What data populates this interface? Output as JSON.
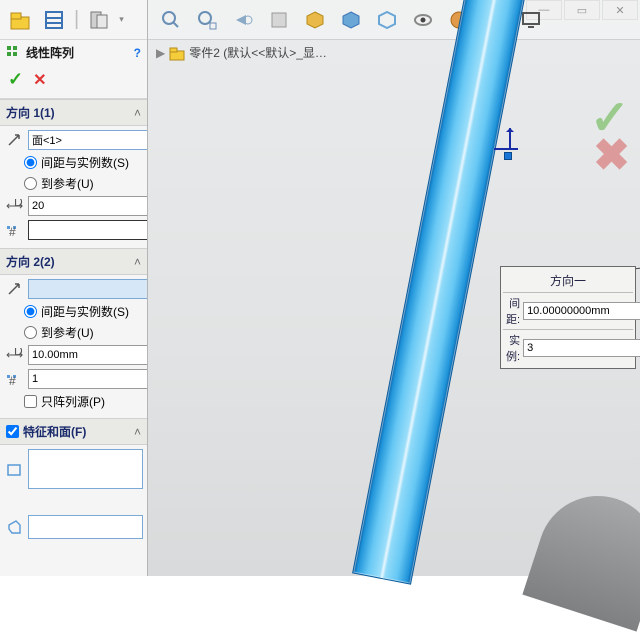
{
  "command": {
    "title": "线性阵列"
  },
  "direction1": {
    "header": "方向 1(1)",
    "ref": "面<1>",
    "opt_spacing": "间距与实例数(S)",
    "opt_toref": "到参考(U)",
    "spacing": "20",
    "count": ""
  },
  "direction2": {
    "header": "方向 2(2)",
    "ref": "",
    "opt_spacing": "间距与实例数(S)",
    "opt_toref": "到参考(U)",
    "spacing": "10.00mm",
    "count": "1",
    "seed_only": "只阵列源(P)"
  },
  "features": {
    "header": "特征和面(F)"
  },
  "breadcrumb": {
    "part": "零件2 (默认<<默认>_显…"
  },
  "callout": {
    "title": "方向一",
    "spacing_label": "间距:",
    "spacing_value": "10.00000000mm",
    "count_label": "实例:",
    "count_value": "3"
  }
}
